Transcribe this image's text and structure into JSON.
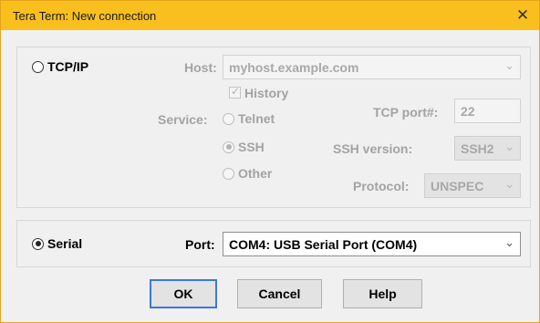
{
  "window": {
    "title": "Tera Term: New connection",
    "close_glyph": "✕"
  },
  "tcpip": {
    "radio_label": "TCP/IP",
    "host_label": "Host:",
    "host_value": "myhost.example.com",
    "history_label": "History",
    "service_label": "Service:",
    "service_options": [
      "Telnet",
      "SSH",
      "Other"
    ],
    "tcp_port_label": "TCP port#:",
    "tcp_port_value": "22",
    "ssh_version_label": "SSH version:",
    "ssh_version_value": "SSH2",
    "protocol_label": "Protocol:",
    "protocol_value": "UNSPEC"
  },
  "serial": {
    "radio_label": "Serial",
    "port_label": "Port:",
    "port_value": "COM4: USB Serial Port (COM4)"
  },
  "buttons": {
    "ok": "OK",
    "cancel": "Cancel",
    "help": "Help"
  },
  "icons": {
    "dropdown": "chevron-down-icon",
    "close": "close-icon"
  },
  "colors": {
    "titlebar": "#f9bf1e",
    "default_button_border": "#3b78d8"
  }
}
